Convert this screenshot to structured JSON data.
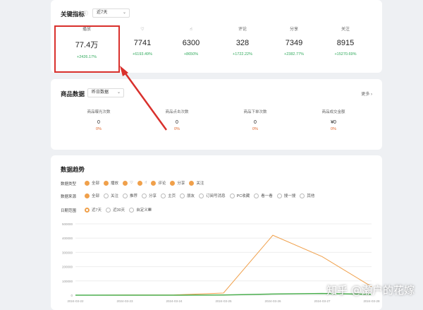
{
  "key_metrics": {
    "title": "关键指标",
    "info_icon": "info-circle-icon",
    "range_value": "近7天",
    "items": [
      {
        "label": "播放",
        "icon": "",
        "value": "77.4万",
        "delta": "+2426.17%"
      },
      {
        "label": "",
        "icon": "heart-icon",
        "value": "7741",
        "delta": "+6193.49%"
      },
      {
        "label": "",
        "icon": "thumbs-up-icon",
        "value": "6300",
        "delta": "+8650%"
      },
      {
        "label": "评论",
        "icon": "",
        "value": "328",
        "delta": "+1722.22%"
      },
      {
        "label": "分享",
        "icon": "",
        "value": "7349",
        "delta": "+2382.77%"
      },
      {
        "label": "关注",
        "icon": "",
        "value": "8915",
        "delta": "+15270.69%"
      }
    ]
  },
  "product_data": {
    "title": "商品数据",
    "range_value": "昨日数据",
    "more_label": "更多",
    "items": [
      {
        "label": "商品曝光次数",
        "value": "0",
        "pct": "0%"
      },
      {
        "label": "商品点击次数",
        "value": "0",
        "pct": "0%"
      },
      {
        "label": "商品下单次数",
        "value": "0",
        "pct": "0%"
      },
      {
        "label": "商品成交金额",
        "value": "¥0",
        "pct": "0%"
      }
    ]
  },
  "trend": {
    "title": "数据趋势",
    "type_label": "数据类型",
    "type_options": [
      {
        "label": "全部",
        "on": true
      },
      {
        "label": "播放",
        "on": true
      },
      {
        "label": "",
        "on": true,
        "icon": "heart-icon"
      },
      {
        "label": "",
        "on": true,
        "icon": "thumbs-up-icon"
      },
      {
        "label": "评论",
        "on": true
      },
      {
        "label": "分享",
        "on": true
      },
      {
        "label": "关注",
        "on": true
      }
    ],
    "source_label": "数据来源",
    "source_options": [
      {
        "label": "全部",
        "on": true
      },
      {
        "label": "关注",
        "on": false
      },
      {
        "label": "推荐",
        "on": false
      },
      {
        "label": "分享",
        "on": false
      },
      {
        "label": "主页",
        "on": false
      },
      {
        "label": "朋友",
        "on": false
      },
      {
        "label": "订阅号消息",
        "on": false
      },
      {
        "label": "PC收藏",
        "on": false
      },
      {
        "label": "看一看",
        "on": false
      },
      {
        "label": "搜一搜",
        "on": false
      },
      {
        "label": "其他",
        "on": false
      }
    ],
    "range_label": "日期范围",
    "range_options": [
      {
        "label": "近7天",
        "on": true
      },
      {
        "label": "近30天",
        "on": false
      },
      {
        "label": "自定义",
        "on": false,
        "icon": "calendar-icon"
      }
    ]
  },
  "chart_data": {
    "type": "line",
    "x": [
      "2024-03-22",
      "2024-03-23",
      "2024-03-24",
      "2024-03-25",
      "2024-03-26",
      "2024-03-27",
      "2024-03-28"
    ],
    "ylim": [
      0,
      500000
    ],
    "yticks": [
      "0",
      "100000",
      "200000",
      "300000",
      "400000",
      "500000"
    ],
    "series": [
      {
        "color": "#f0a04b",
        "values": [
          0,
          1000,
          2000,
          15000,
          420000,
          270000,
          60000
        ]
      },
      {
        "color": "#4caf50",
        "values": [
          0,
          0,
          0,
          1000,
          8000,
          12000,
          6000
        ]
      }
    ],
    "grid": true,
    "legend": "none"
  },
  "watermark": "知乎 @瀬户的花嫁",
  "colors": {
    "accent": "#f0a04b",
    "positive": "#2fa95b",
    "highlight": "#d9302c"
  }
}
